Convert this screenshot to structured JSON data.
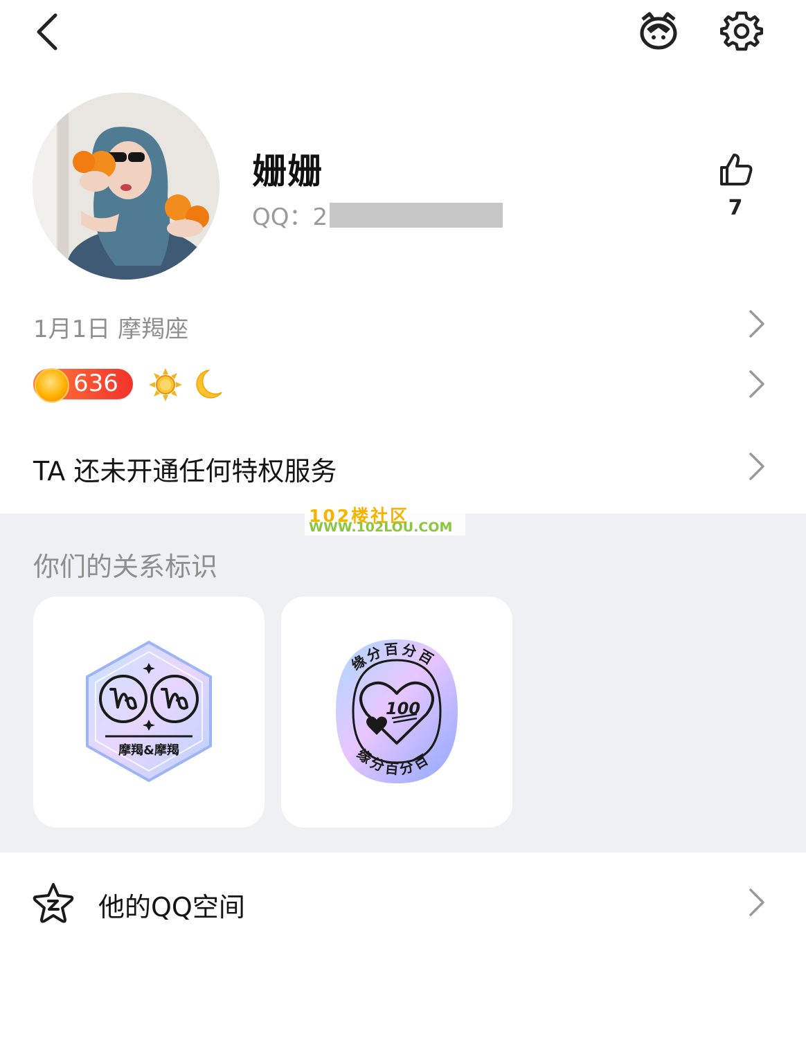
{
  "profile": {
    "nickname": "姗姗",
    "qq_label": "QQ：2",
    "likes": "7"
  },
  "info": {
    "birthday": "1月1日  摩羯座",
    "level": "636",
    "privilege_text": "TA 还未开通任何特权服务"
  },
  "watermark": {
    "line1": "102楼社区",
    "line2": "WWW.102LOU.COM"
  },
  "relationship": {
    "title": "你们的关系标识",
    "badges": [
      {
        "label": "摩羯&摩羯",
        "icon": "capricorn-pair-badge"
      },
      {
        "ring_text": "缘分百分百",
        "number": "100",
        "icon": "fate-100-badge"
      }
    ]
  },
  "qzone": {
    "label": "他的QQ空间",
    "icon": "qzone-star-icon"
  },
  "colors": {
    "section_bg": "#eff0f4",
    "level_red": "#f3322a",
    "muted_text": "#8e8e8e"
  }
}
